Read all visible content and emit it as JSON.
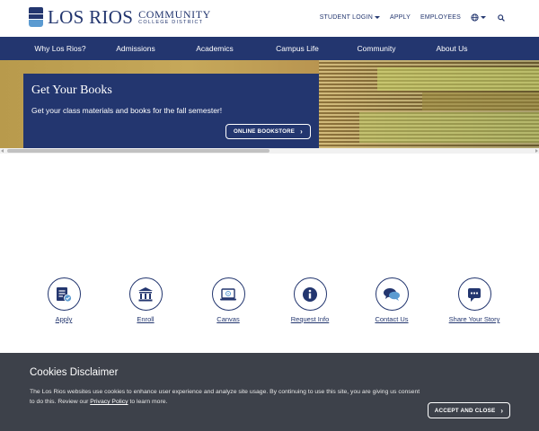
{
  "logo": {
    "main": "LOS RIOS",
    "line1": "COMMUNITY",
    "line2": "COLLEGE DISTRICT"
  },
  "utility": {
    "student_login": "STUDENT LOGIN",
    "apply": "APPLY",
    "employees": "EMPLOYEES",
    "globe_icon": "globe-icon",
    "search_icon": "search-icon"
  },
  "nav": {
    "items": [
      {
        "label": "Why Los Rios?"
      },
      {
        "label": "Admissions"
      },
      {
        "label": "Academics"
      },
      {
        "label": "Campus Life"
      },
      {
        "label": "Community"
      },
      {
        "label": "About Us"
      }
    ]
  },
  "hero": {
    "title": "Get Your Books",
    "subtitle": "Get your class materials and books for the fall semester!",
    "button": "ONLINE BOOKSTORE"
  },
  "quick_links": [
    {
      "label": "Apply",
      "icon": "application-form-icon"
    },
    {
      "label": "Enroll",
      "icon": "institution-building-icon"
    },
    {
      "label": "Canvas",
      "icon": "laptop-icon"
    },
    {
      "label": "Request Info",
      "icon": "info-icon"
    },
    {
      "label": "Contact Us",
      "icon": "chat-bubbles-icon"
    },
    {
      "label": "Share Your Story",
      "icon": "message-icon"
    }
  ],
  "cookie": {
    "title": "Cookies Disclaimer",
    "text_before": "The Los Rios websites use cookies to enhance user experience and analyze site usage. By continuing to use this site, you are giving us consent to do this. Review our ",
    "link": "Privacy Policy",
    "text_after": " to learn more.",
    "button": "ACCEPT AND CLOSE"
  },
  "colors": {
    "navy": "#23366f",
    "accent_blue": "#5b9bd1",
    "cookie_bg": "#3d414a"
  }
}
